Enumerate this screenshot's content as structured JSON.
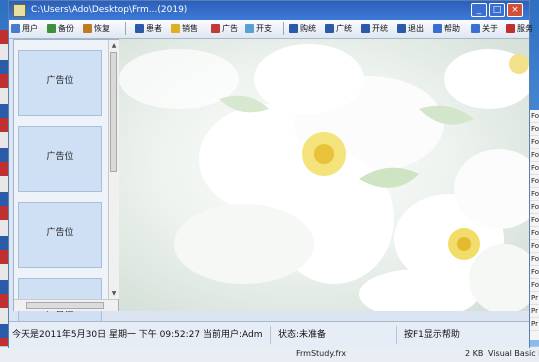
{
  "window": {
    "title": "C:\\Users\\Ado\\Desktop\\Frm...(2019)"
  },
  "toolbar": {
    "items": [
      {
        "label": "用户",
        "icon": "user-icon",
        "color": "#4a7bd0"
      },
      {
        "label": "备份",
        "icon": "backup-icon",
        "color": "#3f8f3f"
      },
      {
        "label": "恢复",
        "icon": "restore-icon",
        "color": "#c07a20"
      },
      {
        "label": "患者",
        "icon": "patient-icon",
        "color": "#2a5aa8"
      },
      {
        "label": "销售",
        "icon": "sales-icon",
        "color": "#e0b020"
      },
      {
        "label": "广告",
        "icon": "ad-icon",
        "color": "#c03a3a"
      },
      {
        "label": "开支",
        "icon": "expense-icon",
        "color": "#5aa0d0"
      },
      {
        "label": "购统",
        "icon": "purchase-stats-icon",
        "color": "#2a5aa8"
      },
      {
        "label": "广统",
        "icon": "ad-stats-icon",
        "color": "#2a5aa8"
      },
      {
        "label": "开统",
        "icon": "expense-stats-icon",
        "color": "#2a5aa8"
      },
      {
        "label": "退出",
        "icon": "exit-icon",
        "color": "#2a5aa8"
      },
      {
        "label": "帮助",
        "icon": "help-icon",
        "color": "#3a6fd0"
      },
      {
        "label": "关于",
        "icon": "about-icon",
        "color": "#3a6fd0"
      },
      {
        "label": "服务",
        "icon": "service-icon",
        "color": "#c03030"
      }
    ]
  },
  "sidebar": {
    "ad_slots": [
      {
        "label": "广告位"
      },
      {
        "label": "广告位"
      },
      {
        "label": "广告位"
      },
      {
        "label": "广告位"
      }
    ]
  },
  "statusbar": {
    "date_text": "今天是2011年5月30日 星期一 下午 09:52:27 当前用户:Adm",
    "status_text": "状态:未准备",
    "hint_text": "按F1显示帮助"
  },
  "taskbar": {
    "file_name": "FrmStudy.frx",
    "file_size": "2 KB",
    "file_type": "Visual Basic For"
  },
  "right_panel": {
    "items": [
      "Fo",
      "Fo",
      "Fo",
      "Fo",
      "Fo",
      "Fo",
      "Fo",
      "Fo",
      "Fo",
      "Fo",
      "Fo",
      "Fo",
      "Fo",
      "Fo",
      "Pr",
      "Pr",
      "Pr"
    ]
  }
}
